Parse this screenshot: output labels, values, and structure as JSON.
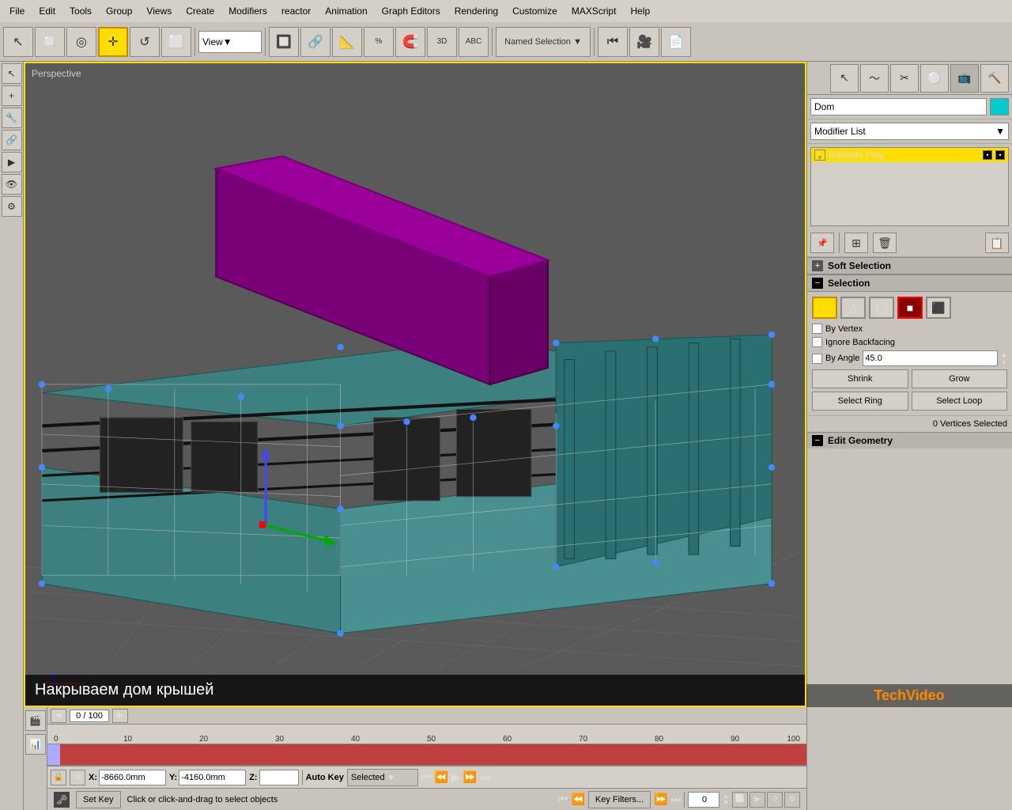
{
  "menubar": {
    "items": [
      "File",
      "Edit",
      "Tools",
      "Group",
      "Views",
      "Create",
      "Modifiers",
      "reactor",
      "Animation",
      "Graph Editors",
      "Rendering",
      "Customize",
      "MAXScript",
      "Help"
    ]
  },
  "toolbar": {
    "view_dropdown": "View",
    "icons": [
      "⬜",
      "⬛",
      "◎",
      "✛",
      "↺",
      "⬜",
      "▸",
      "🔧",
      "⬡",
      "💎",
      "🔄",
      "🔑",
      "⚙",
      "ABC",
      "🔵"
    ]
  },
  "viewport": {
    "label": "Perspective",
    "caption": "Накрываем дом крышей"
  },
  "timeline": {
    "counter": "0 / 100",
    "ruler_ticks": [
      "0",
      "10",
      "20",
      "30",
      "40",
      "50",
      "60",
      "70",
      "80",
      "90",
      "100"
    ]
  },
  "statusbar": {
    "coord_x_label": "X:",
    "coord_x_value": "-8660.0mm",
    "coord_y_label": "Y:",
    "coord_y_value": "-4160.0mm",
    "coord_z_label": "Z:",
    "coord_z_value": "",
    "auto_key_label": "Auto Key",
    "selected_label": "Selected",
    "set_key_label": "Set Key",
    "key_filters_label": "Key Filters...",
    "status_text": "Click or click-and-drag to select objects",
    "frame_number": "0"
  },
  "right_panel": {
    "object_name": "Dom",
    "modifier_list_label": "Modifier List",
    "modifier_stack": [
      {
        "name": "Editable Poly",
        "active": true
      }
    ],
    "soft_selection_label": "Soft Selection",
    "selection_label": "Selection",
    "by_vertex_label": "By Vertex",
    "by_vertex_checked": false,
    "ignore_backfacing_label": "Ignore Backfacing",
    "ignore_backfacing_checked": true,
    "by_angle_label": "By Angle",
    "by_angle_checked": false,
    "angle_value": "45.0",
    "shrink_label": "Shrink",
    "grow_label": "Grow",
    "status_text": "0 Vertices Selected",
    "edit_geometry_label": "Edit Geometry"
  },
  "watermark": {
    "text": "TechVideo"
  }
}
